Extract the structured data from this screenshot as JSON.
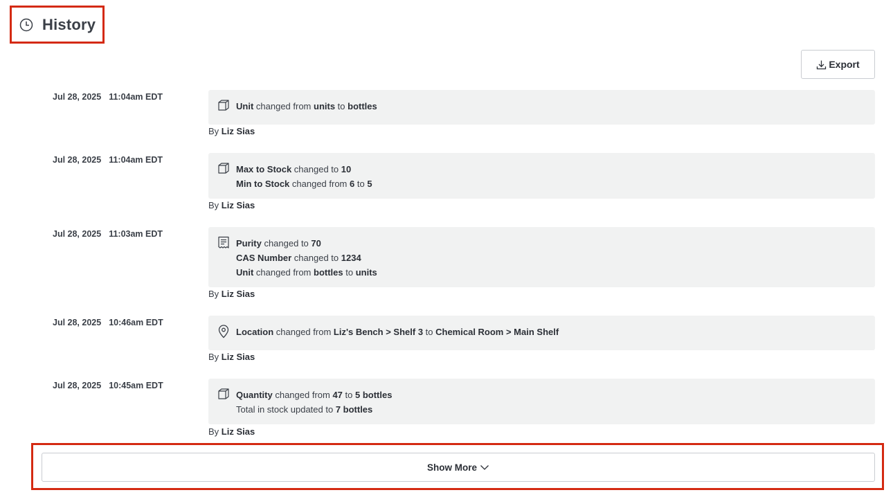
{
  "header": {
    "title": "History",
    "icon": "clock-icon"
  },
  "toolbar": {
    "export_label": "Export",
    "export_icon": "download-icon"
  },
  "entries": [
    {
      "date": "Jul 28, 2025",
      "time": "11:04am EDT",
      "icon": "box-icon",
      "lines": [
        [
          {
            "t": "Unit",
            "b": true
          },
          {
            "t": " changed from "
          },
          {
            "t": "units",
            "b": true
          },
          {
            "t": " to "
          },
          {
            "t": "bottles",
            "b": true
          }
        ]
      ],
      "by_prefix": "By ",
      "by_name": "Liz Sias"
    },
    {
      "date": "Jul 28, 2025",
      "time": "11:04am EDT",
      "icon": "box-icon",
      "lines": [
        [
          {
            "t": "Max to Stock",
            "b": true
          },
          {
            "t": " changed to "
          },
          {
            "t": "10",
            "b": true
          }
        ],
        [
          {
            "t": "Min to Stock",
            "b": true
          },
          {
            "t": " changed from "
          },
          {
            "t": "6",
            "b": true
          },
          {
            "t": " to "
          },
          {
            "t": "5",
            "b": true
          }
        ]
      ],
      "by_prefix": "By ",
      "by_name": "Liz Sias"
    },
    {
      "date": "Jul 28, 2025",
      "time": "11:03am EDT",
      "icon": "receipt-icon",
      "lines": [
        [
          {
            "t": "Purity",
            "b": true
          },
          {
            "t": " changed to "
          },
          {
            "t": "70",
            "b": true
          }
        ],
        [
          {
            "t": "CAS Number",
            "b": true
          },
          {
            "t": " changed to "
          },
          {
            "t": "1234",
            "b": true
          }
        ],
        [
          {
            "t": "Unit",
            "b": true
          },
          {
            "t": " changed from "
          },
          {
            "t": "bottles",
            "b": true
          },
          {
            "t": " to "
          },
          {
            "t": "units",
            "b": true
          }
        ]
      ],
      "by_prefix": "By ",
      "by_name": "Liz Sias"
    },
    {
      "date": "Jul 28, 2025",
      "time": "10:46am EDT",
      "icon": "location-pin-icon",
      "lines": [
        [
          {
            "t": "Location",
            "b": true
          },
          {
            "t": " changed from "
          },
          {
            "t": "Liz's Bench > Shelf 3",
            "b": true
          },
          {
            "t": " to "
          },
          {
            "t": "Chemical Room > Main Shelf",
            "b": true
          }
        ]
      ],
      "by_prefix": "By ",
      "by_name": "Liz Sias"
    },
    {
      "date": "Jul 28, 2025",
      "time": "10:45am EDT",
      "icon": "box-icon",
      "lines": [
        [
          {
            "t": "Quantity",
            "b": true
          },
          {
            "t": " changed from "
          },
          {
            "t": "47",
            "b": true
          },
          {
            "t": " to "
          },
          {
            "t": "5 bottles",
            "b": true
          }
        ],
        [
          {
            "t": "Total in stock updated to "
          },
          {
            "t": "7 bottles",
            "b": true
          }
        ]
      ],
      "by_prefix": "By ",
      "by_name": "Liz Sias"
    }
  ],
  "footer": {
    "show_more_label": "Show More",
    "show_more_icon": "chevron-down-icon"
  },
  "colors": {
    "highlight": "#d42a12",
    "box_bg": "#f1f2f2",
    "text": "#2b2f36"
  }
}
